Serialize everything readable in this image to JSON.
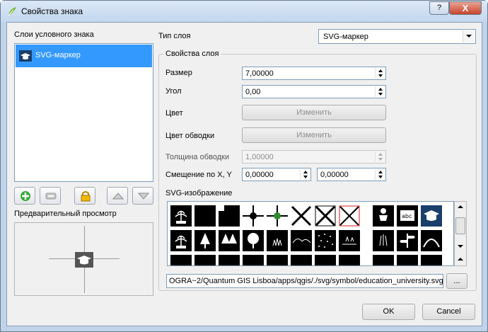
{
  "window": {
    "title": "Свойства знака",
    "help": "?",
    "close": "X"
  },
  "layers_panel": {
    "label": "Слои условного знака",
    "items": [
      {
        "label": "SVG-маркер"
      }
    ]
  },
  "preview": {
    "label": "Предварительный просмотр"
  },
  "layer_type": {
    "label": "Тип слоя",
    "value": "SVG-маркер"
  },
  "props": {
    "group_title": "Свойства слоя",
    "size_label": "Размер",
    "size_value": "7,00000",
    "angle_label": "Угол",
    "angle_value": "0,00",
    "color_label": "Цвет",
    "color_button": "Изменить",
    "border_color_label": "Цвет обводки",
    "border_color_button": "Изменить",
    "border_width_label": "Толщина обводки",
    "border_width_value": "1,00000",
    "offset_label": "Смещение по X, Y",
    "offset_x": "0,00000",
    "offset_y": "0,00000",
    "svg_label": "SVG-изображение",
    "svg_path": "OGRA~2/Quantum GIS Lisboa/apps/qgis/./svg/symbol/education_university.svg",
    "browse": "..."
  },
  "svg_icons": [
    "fountain-icon",
    "filled-square-icon",
    "square-notch-icon",
    "crosshair-icon",
    "crosshair-green-icon",
    "x-mark-icon",
    "x-box-icon",
    "x-box-red-icon",
    "baby-icon",
    "abc-icon",
    "university-icon",
    "fountain-icon",
    "tree-icon",
    "trees-icon",
    "tree-round-icon",
    "grass-icon",
    "hills-icon",
    "dots-icon",
    "marsh-icon",
    "reeds-icon",
    "signpost-icon",
    "mound-icon"
  ],
  "footer": {
    "ok": "OK",
    "cancel": "Cancel"
  },
  "colors": {
    "selection": "#3399ff",
    "accent_blue": "#1a3f6a"
  }
}
